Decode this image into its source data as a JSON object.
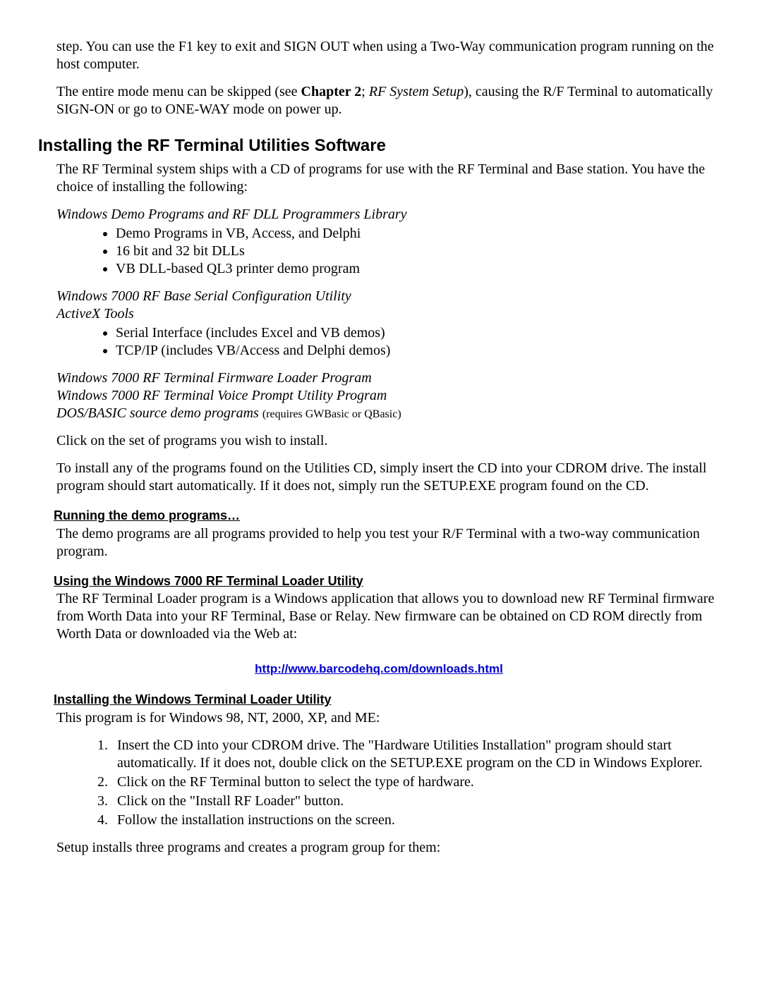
{
  "p1_a": "step.  You can use the F1 key to exit and SIGN OUT when using a Two-Way communication program running on the host computer.",
  "p2_a": "The entire mode menu can be skipped (see ",
  "p2_b_bold": "Chapter 2",
  "p2_c": "; ",
  "p2_d_italic": "RF System Setup",
  "p2_e": "), causing the R/F Terminal to automatically SIGN-ON or go to ONE-WAY mode on power up.",
  "h1": "Installing the RF Terminal Utilities Software",
  "p3": "The RF Terminal system ships with a CD of programs for use with the RF Terminal and Base station.  You have the choice of installing the following:",
  "ih1": "Windows Demo Programs and RF DLL Programmers Library",
  "list1": [
    "Demo Programs in VB, Access, and Delphi",
    "16 bit and 32 bit DLLs",
    "VB DLL-based QL3 printer demo program"
  ],
  "ih2a": "Windows 7000 RF Base Serial Configuration Utility",
  "ih2b": "ActiveX Tools",
  "list2": [
    "Serial Interface (includes Excel and VB demos)",
    "TCP/IP (includes VB/Access and Delphi demos)"
  ],
  "ib_line1": "Windows 7000 RF Terminal Firmware Loader Program",
  "ib_line2": "Windows 7000 RF Terminal Voice Prompt Utility Program",
  "ib_line3_a": "DOS/BASIC source demo programs ",
  "ib_line3_b": "(requires GWBasic or QBasic)",
  "p4": "Click on the set of programs you wish to install.",
  "p5": "To install any of the programs found on the Utilities CD, simply insert the CD into your CDROM drive. The install program should start automatically.  If it does not, simply run the SETUP.EXE program found on the CD.",
  "sh1": "Running the demo programs…",
  "p6": "The demo programs are all programs provided to help you test your R/F Terminal with a two-way communication program.",
  "sh2": "Using the Windows 7000 RF Terminal Loader Utility",
  "p7": "The RF Terminal Loader program is a Windows application that allows you to download new RF Terminal firmware from Worth Data into your RF Terminal, Base or Relay.  New firmware can be obtained on CD ROM directly from Worth Data or downloaded via the Web at:",
  "link_text": "http://www.barcodehq.com/downloads.html",
  "link_href": "http://www.barcodehq.com/downloads.html",
  "sh3": "Installing the Windows Terminal Loader Utility",
  "p8": "This program is for Windows 98, NT, 2000, XP, and ME:",
  "olist": [
    "Insert the CD into your CDROM drive. The \"Hardware Utilities Installation\" program should start automatically. If it does not, double click on the SETUP.EXE program on the CD in Windows Explorer.",
    "Click on the RF Terminal button to select the type of hardware.",
    "Click on the \"Install RF Loader\" button.",
    "Follow the installation instructions on the screen."
  ],
  "p9": "Setup installs three programs and creates a program group for them:"
}
